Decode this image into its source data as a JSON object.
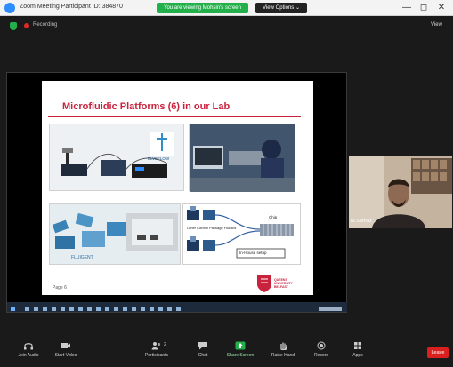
{
  "window": {
    "title": "Zoom Meeting Participant ID: 384870",
    "banner": "You are viewing Mohsin's screen",
    "view_options": "View Options ⌄",
    "controls": [
      "—",
      "◻",
      "✕"
    ]
  },
  "meeting_bar": {
    "recording_label": "Recording",
    "view_label": "View"
  },
  "slide": {
    "title": "Microfluidic Platforms (6) in our Lab",
    "photo1_label": "ELVEFLOW",
    "photo3_label": "FLUIGENT",
    "photo4_labels": [
      "Chip",
      "Other Control Package Fluidics",
      "In-House setup"
    ],
    "page_number": "Page 6",
    "logo_label": "QUEENS UNIVERSITY BELFAST"
  },
  "participant": {
    "name": "M.Sarfraz"
  },
  "toolbar": {
    "items": [
      {
        "label": "Join Audio",
        "icon": "headphones-icon"
      },
      {
        "label": "Start Video",
        "icon": "video-camera-icon"
      },
      {
        "label": "Participants",
        "icon": "participants-icon",
        "count": "2"
      },
      {
        "label": "Chat",
        "icon": "chat-icon"
      },
      {
        "label": "Share Screen",
        "icon": "share-screen-icon"
      },
      {
        "label": "Raise Hand",
        "icon": "hand-icon"
      },
      {
        "label": "Record",
        "icon": "record-icon"
      },
      {
        "label": "Apps",
        "icon": "apps-icon"
      }
    ],
    "end_label": "Leave"
  },
  "colors": {
    "accent_green": "#23b04a",
    "slide_title_red": "#c9223d",
    "end_red": "#d9201f"
  }
}
